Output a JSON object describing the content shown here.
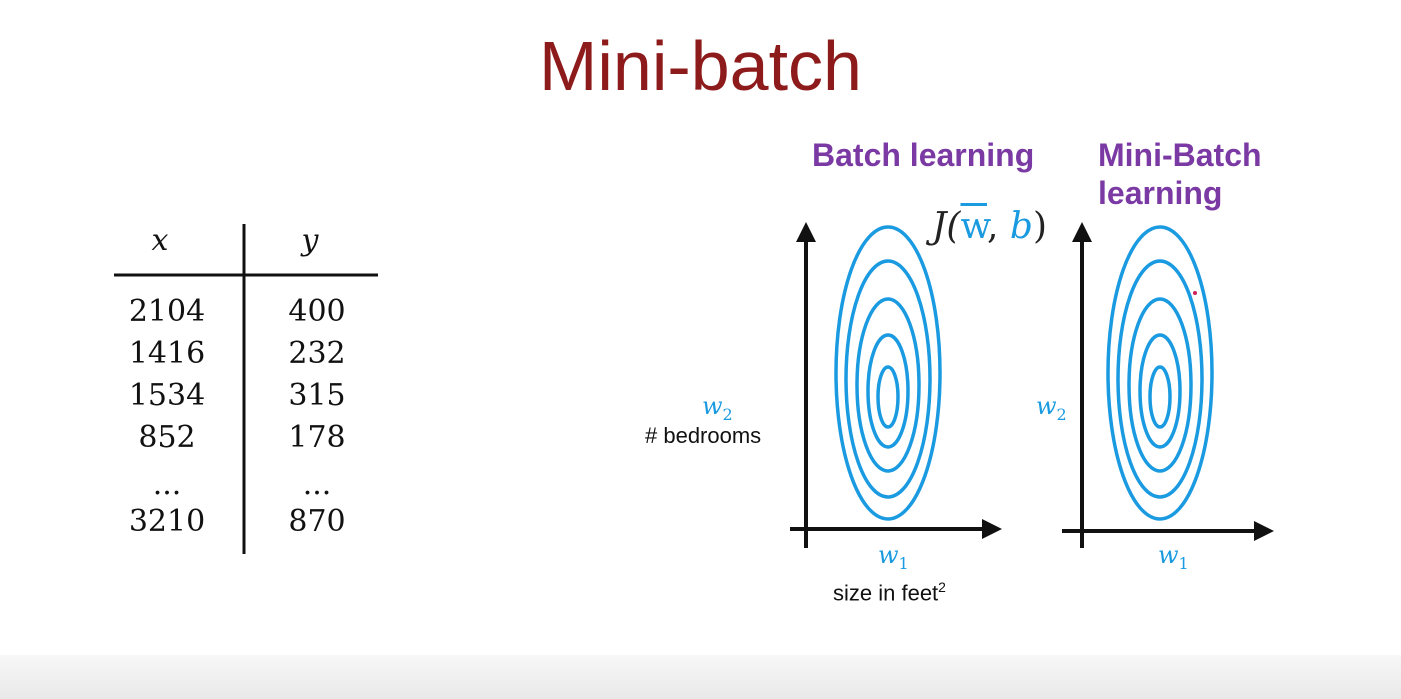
{
  "title": "Mini-batch",
  "table": {
    "headers": [
      "x",
      "y"
    ],
    "rows": [
      [
        "2104",
        "400"
      ],
      [
        "1416",
        "232"
      ],
      [
        "1534",
        "315"
      ],
      [
        "852",
        "178"
      ],
      [
        "...",
        "..."
      ],
      [
        "3210",
        "870"
      ]
    ]
  },
  "batch_plot": {
    "heading": "Batch learning",
    "cost_function": {
      "prefix": "J(",
      "w": "w",
      "comma": ", ",
      "b": "b",
      "suffix": ")"
    },
    "y_axis": {
      "var": "w",
      "sub": "2",
      "caption": "# bedrooms"
    },
    "x_axis": {
      "var": "w",
      "sub": "1",
      "caption": "size in feet",
      "caption_sup": "2"
    },
    "contour_levels": 5
  },
  "minibatch_plot": {
    "heading_line1": "Mini-Batch",
    "heading_line2": "learning",
    "y_axis": {
      "var": "w",
      "sub": "2"
    },
    "x_axis": {
      "var": "w",
      "sub": "1"
    },
    "contour_levels": 5
  },
  "colors": {
    "title": "#8e1b1b",
    "heading": "#7a39a3",
    "contour": "#1a9ae0",
    "axis": "#111111",
    "marker": "#cc2255"
  }
}
